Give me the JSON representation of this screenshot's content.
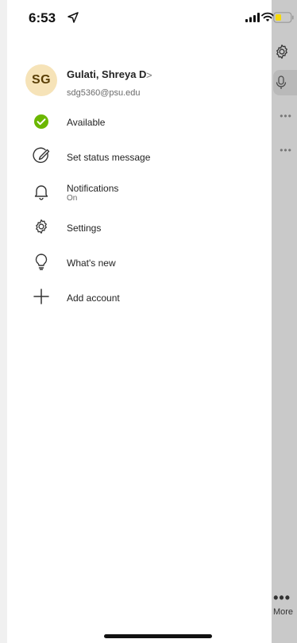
{
  "status_bar": {
    "time": "6:53"
  },
  "background_app": {
    "more_label": "More"
  },
  "profile": {
    "initials": "SG",
    "name": "Gulati, Shreya D",
    "email": "sdg5360@psu.edu"
  },
  "menu": {
    "available": "Available",
    "status_message": "Set status message",
    "notifications": "Notifications",
    "notifications_state": "On",
    "settings": "Settings",
    "whats_new": "What's new",
    "add_account": "Add account"
  },
  "colors": {
    "available_green": "#6bb700",
    "avatar_bg": "#f6e3b8"
  }
}
